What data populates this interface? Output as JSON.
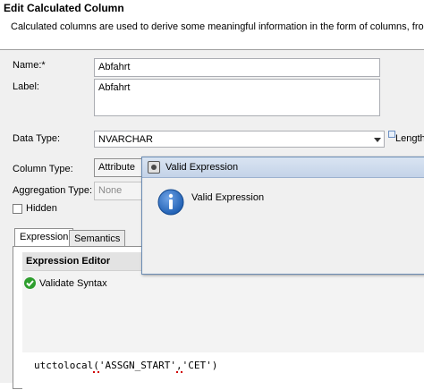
{
  "header": {
    "title": "Edit Calculated Column",
    "description": "Calculated columns are used to derive some meaningful information in the form of columns, from"
  },
  "form": {
    "name_label": "Name:*",
    "name_value": "Abfahrt",
    "label_label": "Label:",
    "label_value": "Abfahrt",
    "data_type_label": "Data Type:",
    "data_type_value": "NVARCHAR",
    "length_label": "Length",
    "column_type_label": "Column Type:",
    "column_type_value": "Attribute",
    "aggregation_type_label": "Aggregation Type:",
    "aggregation_type_value": "None",
    "hidden_label": "Hidden",
    "hidden_checked": false
  },
  "tabs": [
    {
      "label": "Expression",
      "active": true
    },
    {
      "label": "Semantics",
      "active": false
    }
  ],
  "expression_editor": {
    "title": "Expression Editor",
    "validate_label": "Validate Syntax",
    "code_func": "utctolocal",
    "code_open": "(",
    "code_arg1": "'ASSGN_START'",
    "code_comma": ",",
    "code_arg2": "'CET'",
    "code_close": ")"
  },
  "dialog": {
    "title": "Valid Expression",
    "message": "Valid Expression"
  },
  "colors": {
    "form_background": "#f0f0f0",
    "dialog_border": "#6a8bb3",
    "info_icon": "#1f5fb3",
    "validate_icon": "#2e9e2e",
    "error_underline": "#d00000"
  }
}
